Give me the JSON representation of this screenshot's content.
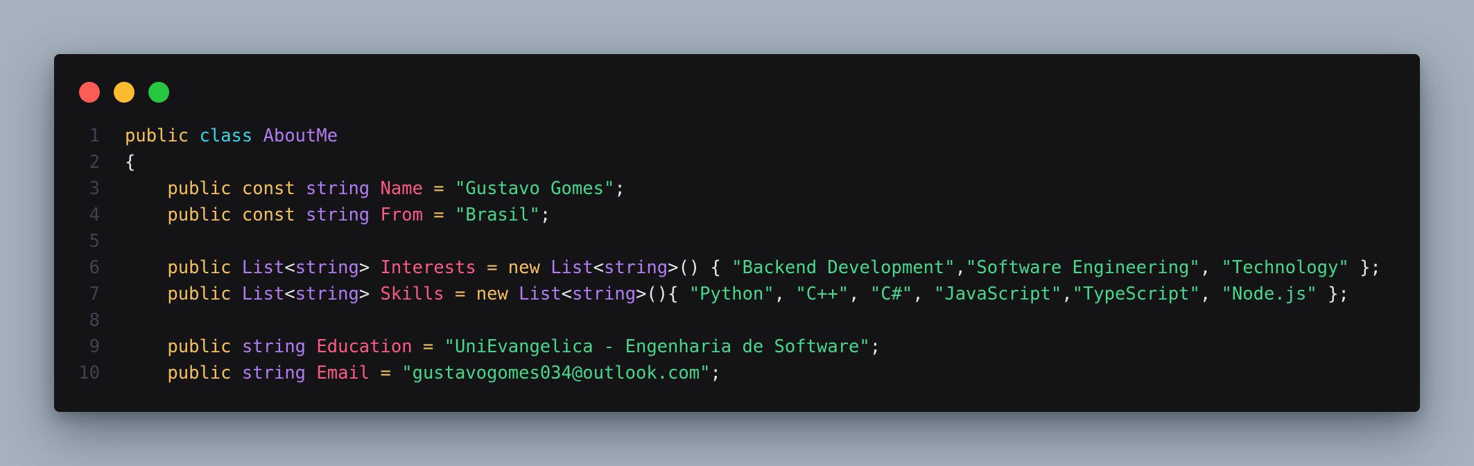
{
  "colors": {
    "background": "#a5b1bd",
    "editor_background": "#141417",
    "line_number": "#3f4350",
    "keyword": "#f6c15a",
    "class_keyword": "#37d3e3",
    "type": "#b27cf2",
    "identifier": "#fb5a86",
    "string": "#46d88a",
    "punctuation": "#e8e8ec"
  },
  "window_controls": [
    {
      "name": "close-icon",
      "color": "#fd5d55"
    },
    {
      "name": "minimize-icon",
      "color": "#fdbb2e"
    },
    {
      "name": "maximize-icon",
      "color": "#27c840"
    }
  ],
  "code_lines": [
    {
      "num": "1",
      "tokens": [
        {
          "t": "public",
          "k": "kw"
        },
        {
          "t": " ",
          "k": "plain"
        },
        {
          "t": "class",
          "k": "cls"
        },
        {
          "t": " ",
          "k": "plain"
        },
        {
          "t": "AboutMe",
          "k": "type"
        }
      ]
    },
    {
      "num": "2",
      "tokens": [
        {
          "t": "{",
          "k": "punc"
        }
      ]
    },
    {
      "num": "3",
      "tokens": [
        {
          "t": "    ",
          "k": "plain"
        },
        {
          "t": "public",
          "k": "kw"
        },
        {
          "t": " ",
          "k": "plain"
        },
        {
          "t": "const",
          "k": "kw"
        },
        {
          "t": " ",
          "k": "plain"
        },
        {
          "t": "string",
          "k": "type"
        },
        {
          "t": " ",
          "k": "plain"
        },
        {
          "t": "Name",
          "k": "ident"
        },
        {
          "t": " ",
          "k": "plain"
        },
        {
          "t": "=",
          "k": "op"
        },
        {
          "t": " ",
          "k": "plain"
        },
        {
          "t": "\"Gustavo Gomes\"",
          "k": "str"
        },
        {
          "t": ";",
          "k": "punc"
        }
      ]
    },
    {
      "num": "4",
      "tokens": [
        {
          "t": "    ",
          "k": "plain"
        },
        {
          "t": "public",
          "k": "kw"
        },
        {
          "t": " ",
          "k": "plain"
        },
        {
          "t": "const",
          "k": "kw"
        },
        {
          "t": " ",
          "k": "plain"
        },
        {
          "t": "string",
          "k": "type"
        },
        {
          "t": " ",
          "k": "plain"
        },
        {
          "t": "From",
          "k": "ident"
        },
        {
          "t": " ",
          "k": "plain"
        },
        {
          "t": "=",
          "k": "op"
        },
        {
          "t": " ",
          "k": "plain"
        },
        {
          "t": "\"Brasil\"",
          "k": "str"
        },
        {
          "t": ";",
          "k": "punc"
        }
      ]
    },
    {
      "num": "5",
      "tokens": []
    },
    {
      "num": "6",
      "tokens": [
        {
          "t": "    ",
          "k": "plain"
        },
        {
          "t": "public",
          "k": "kw"
        },
        {
          "t": " ",
          "k": "plain"
        },
        {
          "t": "List",
          "k": "type"
        },
        {
          "t": "<",
          "k": "punc"
        },
        {
          "t": "string",
          "k": "type"
        },
        {
          "t": ">",
          "k": "punc"
        },
        {
          "t": " ",
          "k": "plain"
        },
        {
          "t": "Interests",
          "k": "ident"
        },
        {
          "t": " ",
          "k": "plain"
        },
        {
          "t": "=",
          "k": "op"
        },
        {
          "t": " ",
          "k": "plain"
        },
        {
          "t": "new",
          "k": "kw"
        },
        {
          "t": " ",
          "k": "plain"
        },
        {
          "t": "List",
          "k": "type"
        },
        {
          "t": "<",
          "k": "punc"
        },
        {
          "t": "string",
          "k": "type"
        },
        {
          "t": ">() { ",
          "k": "punc"
        },
        {
          "t": "\"Backend Development\"",
          "k": "str"
        },
        {
          "t": ",",
          "k": "punc"
        },
        {
          "t": "\"Software Engineering\"",
          "k": "str"
        },
        {
          "t": ", ",
          "k": "punc"
        },
        {
          "t": "\"Technology\"",
          "k": "str"
        },
        {
          "t": " };",
          "k": "punc"
        }
      ]
    },
    {
      "num": "7",
      "tokens": [
        {
          "t": "    ",
          "k": "plain"
        },
        {
          "t": "public",
          "k": "kw"
        },
        {
          "t": " ",
          "k": "plain"
        },
        {
          "t": "List",
          "k": "type"
        },
        {
          "t": "<",
          "k": "punc"
        },
        {
          "t": "string",
          "k": "type"
        },
        {
          "t": ">",
          "k": "punc"
        },
        {
          "t": " ",
          "k": "plain"
        },
        {
          "t": "Skills",
          "k": "ident"
        },
        {
          "t": " ",
          "k": "plain"
        },
        {
          "t": "=",
          "k": "op"
        },
        {
          "t": " ",
          "k": "plain"
        },
        {
          "t": "new",
          "k": "kw"
        },
        {
          "t": " ",
          "k": "plain"
        },
        {
          "t": "List",
          "k": "type"
        },
        {
          "t": "<",
          "k": "punc"
        },
        {
          "t": "string",
          "k": "type"
        },
        {
          "t": ">(){ ",
          "k": "punc"
        },
        {
          "t": "\"Python\"",
          "k": "str"
        },
        {
          "t": ", ",
          "k": "punc"
        },
        {
          "t": "\"C++\"",
          "k": "str"
        },
        {
          "t": ", ",
          "k": "punc"
        },
        {
          "t": "\"C#\"",
          "k": "str"
        },
        {
          "t": ", ",
          "k": "punc"
        },
        {
          "t": "\"JavaScript\"",
          "k": "str"
        },
        {
          "t": ",",
          "k": "punc"
        },
        {
          "t": "\"TypeScript\"",
          "k": "str"
        },
        {
          "t": ", ",
          "k": "punc"
        },
        {
          "t": "\"Node.js\"",
          "k": "str"
        },
        {
          "t": " };",
          "k": "punc"
        }
      ]
    },
    {
      "num": "8",
      "tokens": []
    },
    {
      "num": "9",
      "tokens": [
        {
          "t": "    ",
          "k": "plain"
        },
        {
          "t": "public",
          "k": "kw"
        },
        {
          "t": " ",
          "k": "plain"
        },
        {
          "t": "string",
          "k": "type"
        },
        {
          "t": " ",
          "k": "plain"
        },
        {
          "t": "Education",
          "k": "ident"
        },
        {
          "t": " ",
          "k": "plain"
        },
        {
          "t": "=",
          "k": "op"
        },
        {
          "t": " ",
          "k": "plain"
        },
        {
          "t": "\"UniEvangelica - Engenharia de Software\"",
          "k": "str"
        },
        {
          "t": ";",
          "k": "punc"
        }
      ]
    },
    {
      "num": "10",
      "tokens": [
        {
          "t": "    ",
          "k": "plain"
        },
        {
          "t": "public",
          "k": "kw"
        },
        {
          "t": " ",
          "k": "plain"
        },
        {
          "t": "string",
          "k": "type"
        },
        {
          "t": " ",
          "k": "plain"
        },
        {
          "t": "Email",
          "k": "ident"
        },
        {
          "t": " ",
          "k": "plain"
        },
        {
          "t": "=",
          "k": "op"
        },
        {
          "t": " ",
          "k": "plain"
        },
        {
          "t": "\"gustavogomes034@outlook.com\"",
          "k": "str"
        },
        {
          "t": ";",
          "k": "punc"
        }
      ]
    }
  ]
}
